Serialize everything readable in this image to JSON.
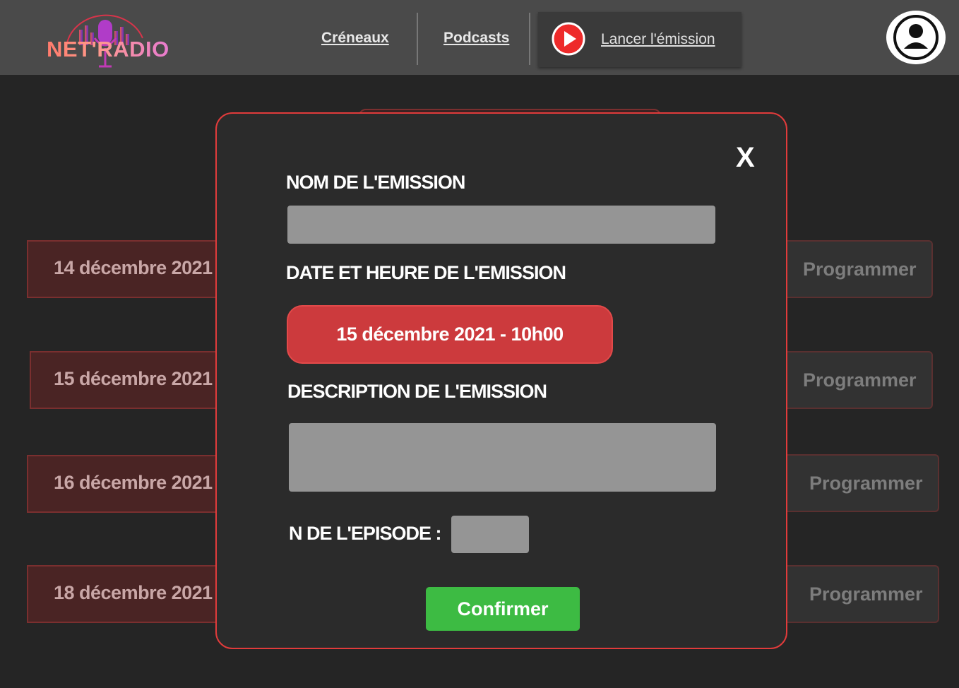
{
  "header": {
    "logo_text": "NET'RADIO",
    "nav": {
      "creneaux": "Créneaux",
      "podcasts": "Podcasts",
      "launch": "Lancer l'émission"
    }
  },
  "rows": [
    {
      "date": "14 décembre 2021",
      "action": "Programmer"
    },
    {
      "date": "15 décembre 2021",
      "action": "Programmer"
    },
    {
      "date": "16 décembre 2021",
      "action": "Programmer"
    },
    {
      "date": "18 décembre 2021",
      "action": "Programmer"
    }
  ],
  "modal": {
    "close": "X",
    "name_label": "NOM DE L'EMISSION",
    "name_value": "",
    "datetime_label": "DATE ET HEURE DE L'EMISSION",
    "datetime_value": "15 décembre 2021 - 10h00",
    "description_label": "DESCRIPTION DE L'EMISSION",
    "description_value": "",
    "episode_label": "N DE L'EPISODE :",
    "episode_value": "",
    "confirm": "Confirmer"
  },
  "colors": {
    "accent_red": "#e13b3b",
    "date_pill": "#cc3a3d",
    "confirm_green": "#3dbb43",
    "header_bg": "#4a4a4a",
    "page_bg": "#252525"
  },
  "icons": {
    "play": "play-circle-icon",
    "user": "user-avatar-icon",
    "logo_mic": "microphone-icon"
  }
}
